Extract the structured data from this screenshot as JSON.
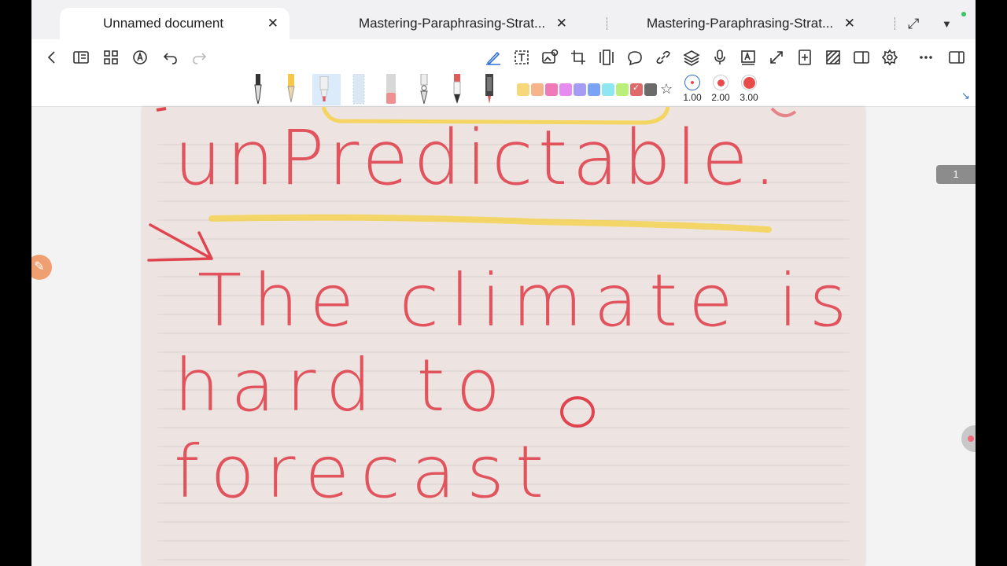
{
  "tabs": [
    {
      "label": "Unnamed document",
      "close": "✕"
    },
    {
      "label": "Mastering-Paraphrasing-Strat...",
      "close": "✕"
    },
    {
      "label": "Mastering-Paraphrasing-Strat...",
      "close": "✕"
    }
  ],
  "tab_actions": {
    "expand": "⤢",
    "dropdown": "▼"
  },
  "colors": [
    "#f6d87a",
    "#f5b48a",
    "#f07ab8",
    "#e68cf0",
    "#a69cf5",
    "#7aa2f5",
    "#8ee6f0",
    "#b9f07a",
    "#e06a6a",
    "#6b6b6b"
  ],
  "pen_sizes": [
    {
      "label": "1.00",
      "color": "#e84b4b"
    },
    {
      "label": "2.00",
      "color": "#e84b4b"
    },
    {
      "label": "3.00",
      "color": "#e84b4b"
    }
  ],
  "handwriting": {
    "line1": "unPredictable.",
    "line2": "The climate is",
    "line3": "hard to forecast"
  },
  "page_number": "1",
  "accent_color": "#2f6fd6",
  "ink_color": "#e0454f",
  "highlight_color": "#f5d24a"
}
